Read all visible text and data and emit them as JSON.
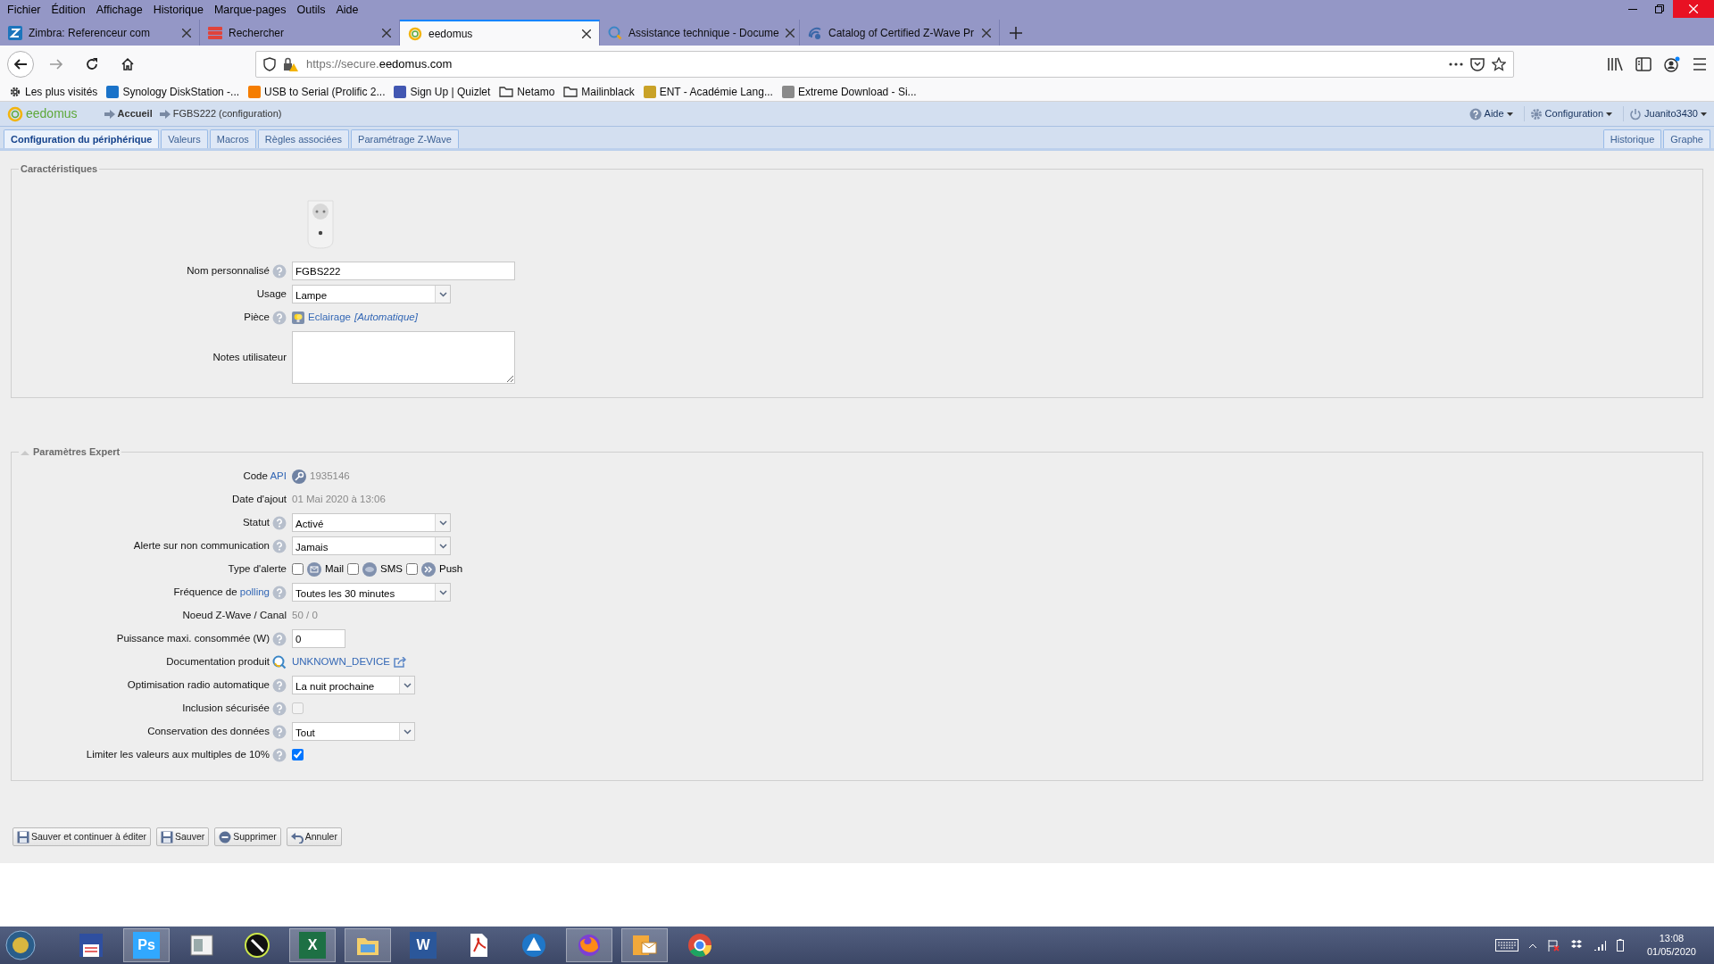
{
  "browser": {
    "menu": [
      "Fichier",
      "Édition",
      "Affichage",
      "Historique",
      "Marque-pages",
      "Outils",
      "Aide"
    ],
    "tabs": [
      {
        "title": "Zimbra: Referenceur com",
        "kind": "zimbra",
        "selected": false
      },
      {
        "title": "Rechercher",
        "kind": "stack",
        "selected": false
      },
      {
        "title": "eedomus",
        "kind": "ring",
        "selected": true
      },
      {
        "title": "Assistance technique - Docume",
        "kind": "search",
        "selected": false
      },
      {
        "title": "Catalog of Certified Z-Wave Pr",
        "kind": "wave",
        "selected": false
      }
    ],
    "url": {
      "prefix": "https://secure.",
      "domain": "eedomus.com"
    },
    "bookmarks": [
      {
        "label": "Les plus visités",
        "kind": "gear"
      },
      {
        "label": "Synology DiskStation -...",
        "kind": "site",
        "color": "#1a73c9"
      },
      {
        "label": "USB to Serial (Prolific 2...",
        "kind": "site",
        "color": "#f57d00"
      },
      {
        "label": "Sign Up | Quizlet",
        "kind": "site",
        "color": "#4257b2"
      },
      {
        "label": "Netamo",
        "kind": "folder"
      },
      {
        "label": "Mailinblack",
        "kind": "folder"
      },
      {
        "label": "ENT - Académie Lang...",
        "kind": "site",
        "color": "#c9a227"
      },
      {
        "label": "Extreme Download - Si...",
        "kind": "site",
        "color": "#8a8a8a"
      }
    ]
  },
  "app": {
    "logo": "eedomus",
    "breadcrumbs": [
      "Accueil",
      "FGBS222 (configuration)"
    ],
    "menus": [
      {
        "label": "Aide",
        "kind": "help"
      },
      {
        "label": "Configuration",
        "kind": "gear"
      },
      {
        "label": "Juanito3430",
        "kind": "power"
      }
    ],
    "tabs": [
      {
        "label": "Configuration du périphérique",
        "selected": true
      },
      {
        "label": "Valeurs",
        "selected": false
      },
      {
        "label": "Macros",
        "selected": false
      },
      {
        "label": "Règles associées",
        "selected": false
      },
      {
        "label": "Paramétrage Z-Wave",
        "selected": false
      }
    ],
    "right_tabs": [
      {
        "label": "Historique",
        "selected": false
      },
      {
        "label": "Graphe",
        "selected": false
      }
    ]
  },
  "characteristics": {
    "legend": "Caractéristiques",
    "fields": [
      {
        "kind": "text",
        "label": "Nom personnalisé",
        "help": true,
        "value": "FGBS222"
      },
      {
        "kind": "select",
        "label": "Usage",
        "help": false,
        "value": "Lampe"
      },
      {
        "kind": "room",
        "label": "Pièce",
        "help": true,
        "value": "Eclairage",
        "note": "[Automatique]"
      },
      {
        "kind": "textarea",
        "label": "Notes utilisateur",
        "help": false
      }
    ]
  },
  "expert": {
    "legend": "Paramètres Expert",
    "fields": [
      {
        "kind": "api",
        "label": "Code",
        "label_link": "API",
        "help": false,
        "value": "1935146"
      },
      {
        "kind": "static",
        "label": "Date d'ajout",
        "help": false,
        "value": "01 Mai 2020 à 13:06"
      },
      {
        "kind": "select",
        "label": "Statut",
        "help": true,
        "value": "Activé"
      },
      {
        "kind": "select",
        "label": "Alerte sur non communication",
        "help": true,
        "value": "Jamais"
      },
      {
        "kind": "alerts",
        "label": "Type d'alerte",
        "help": false,
        "options": [
          {
            "label": "Mail",
            "kind": "mail",
            "checked": false
          },
          {
            "label": "SMS",
            "kind": "sms",
            "checked": false
          },
          {
            "label": "Push",
            "kind": "push",
            "checked": false
          }
        ]
      },
      {
        "kind": "select",
        "label": "Fréquence de",
        "label_link": "polling",
        "help": true,
        "value": "Toutes les 30 minutes"
      },
      {
        "kind": "static",
        "label": "Noeud Z-Wave / Canal",
        "help": false,
        "value": "50 / 0"
      },
      {
        "kind": "number",
        "label": "Puissance maxi. consommée (W)",
        "help": true,
        "value": "0"
      },
      {
        "kind": "doc",
        "label": "Documentation produit",
        "help": false,
        "value": "UNKNOWN_DEVICE"
      },
      {
        "kind": "shortselect",
        "label": "Optimisation radio automatique",
        "help": true,
        "value": "La nuit prochaine"
      },
      {
        "kind": "checkbox",
        "label": "Inclusion sécurisée",
        "help": true,
        "checked": false,
        "disabled": true
      },
      {
        "kind": "shortselect",
        "label": "Conservation des données",
        "help": true,
        "value": "Tout"
      },
      {
        "kind": "checkbox",
        "label": "Limiter les valeurs aux multiples de 10%",
        "help": true,
        "checked": true,
        "disabled": false
      }
    ]
  },
  "buttons": [
    {
      "label": "Sauver et continuer à éditer",
      "kind": "save"
    },
    {
      "label": "Sauver",
      "kind": "save"
    },
    {
      "label": "Supprimer",
      "kind": "delete"
    },
    {
      "label": "Annuler",
      "kind": "undo"
    }
  ],
  "taskbar": {
    "apps": [
      {
        "kind": "floppy",
        "running": false
      },
      {
        "kind": "letter",
        "text": "Ps",
        "color": "#31a8ff",
        "running": true
      },
      {
        "kind": "panel",
        "running": false
      },
      {
        "kind": "pen",
        "running": false
      },
      {
        "kind": "letter",
        "text": "X",
        "color": "#1d7044",
        "running": true
      },
      {
        "kind": "folder",
        "running": true
      },
      {
        "kind": "letter",
        "text": "W",
        "color": "#2b579a",
        "running": false
      },
      {
        "kind": "pdf",
        "running": false
      },
      {
        "kind": "triangle",
        "running": false
      },
      {
        "kind": "browser",
        "running": true
      },
      {
        "kind": "mail",
        "running": true
      },
      {
        "kind": "chrome",
        "running": false
      }
    ],
    "time": "13:08",
    "date": "01/05/2020"
  }
}
